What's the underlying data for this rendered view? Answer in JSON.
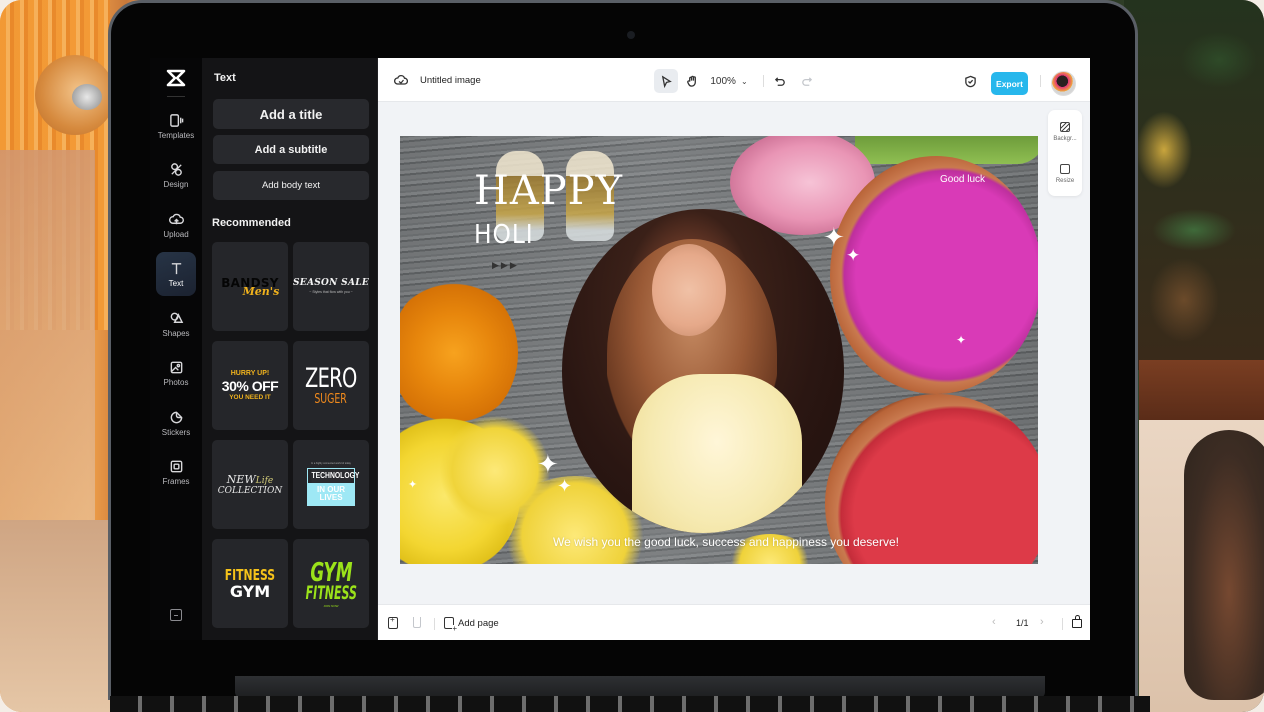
{
  "sidebar": {
    "items": [
      {
        "label": "Templates",
        "icon": "templates-icon"
      },
      {
        "label": "Design",
        "icon": "design-icon"
      },
      {
        "label": "Upload",
        "icon": "upload-icon"
      },
      {
        "label": "Text",
        "icon": "text-icon",
        "active": true
      },
      {
        "label": "Shapes",
        "icon": "shapes-icon"
      },
      {
        "label": "Photos",
        "icon": "photos-icon"
      },
      {
        "label": "Stickers",
        "icon": "stickers-icon"
      },
      {
        "label": "Frames",
        "icon": "frames-icon"
      }
    ]
  },
  "panel": {
    "title": "Text",
    "add_title": "Add a title",
    "add_subtitle": "Add a subtitle",
    "add_body": "Add body text",
    "recommended_label": "Recommended",
    "templates": [
      {
        "line1": "BANDSY",
        "line2": "Men's"
      },
      {
        "line1": "SEASON SALE",
        "line2": "~ Styles that flow with you ~"
      },
      {
        "line1": "HURRY UP!",
        "line2": "30% OFF",
        "line3": "YOU NEED IT"
      },
      {
        "line1": "ZERO",
        "line2": "SUGER"
      },
      {
        "line1": "NEW",
        "line1b": "Life",
        "line2": "COLLECTION"
      },
      {
        "small": "In a highly connected world of today",
        "line1": "TECHNOLOGY",
        "line2": "IN OUR LIVES"
      },
      {
        "line1": "FITNESS",
        "line2": "GYM"
      },
      {
        "line1": "GYM",
        "line2": "FITNESS",
        "line3": "JOIN NOW"
      }
    ]
  },
  "topbar": {
    "doc_title": "Untitled image",
    "zoom_level": "100%",
    "export_label": "Export"
  },
  "side_tools": {
    "background_label": "Backgr...",
    "resize_label": "Resize"
  },
  "canvas": {
    "happy": "HAPPY",
    "holi": "HOLI",
    "arrows": "▶▶▶",
    "good_luck": "Good luck",
    "wish": "We wish you the good luck, success and happiness you deserve!"
  },
  "bottombar": {
    "add_page_label": "Add page",
    "page_indicator": "1/1"
  },
  "colors": {
    "accent_export": "#27b7ec",
    "sidebar_bg": "#060607",
    "panel_bg": "#141416",
    "canvas_bg": "#f1f3f6"
  }
}
